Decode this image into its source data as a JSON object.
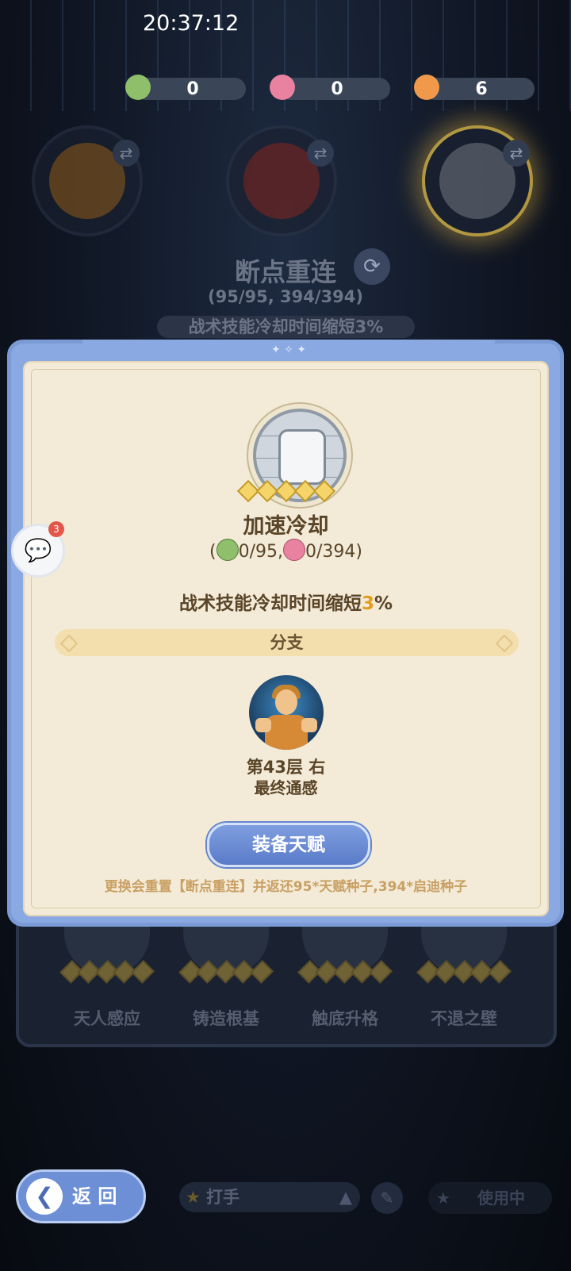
{
  "status_bar": {
    "time": "20:37:12"
  },
  "resources": [
    {
      "name": "green-seed",
      "value": "0",
      "color": "#8fbf6a"
    },
    {
      "name": "pink-seed",
      "value": "0",
      "color": "#e882a0"
    },
    {
      "name": "orange-seed",
      "value": "6",
      "color": "#f0994a"
    }
  ],
  "background_skill": {
    "title": "断点重连",
    "cost": "(95/95, 394/394)",
    "desc": "战术技能冷却时间缩短3%"
  },
  "background_tree": {
    "labels": [
      "天人感应",
      "铸造根基",
      "触底升格",
      "不退之壁"
    ]
  },
  "modal": {
    "skill_name": "加速冷却",
    "cost_open": "(",
    "cost_a": "0/95,",
    "cost_b": "0/394)",
    "desc_pre": "战术技能冷却时间缩短",
    "desc_value": "3",
    "desc_post": "%",
    "branch_label": "分支",
    "floor_line": "第43层  右",
    "floor_sub": "最终通感",
    "equip_label": "装备天赋",
    "warning": "更换会重置【断点重连】并返还95*天赋种子,394*启迪种子"
  },
  "chat": {
    "badge": "3"
  },
  "bottom": {
    "back_label": "返 回",
    "preset_label": "打手",
    "using_label": "使用中"
  }
}
